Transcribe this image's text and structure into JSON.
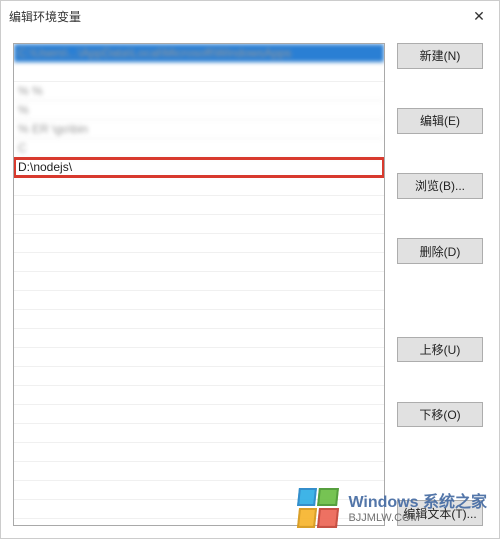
{
  "dialog": {
    "title": "编辑环境变量"
  },
  "list": {
    "items": [
      {
        "text": "C:\\Users\\...\\AppData\\Local\\Microsoft\\WindowsApps",
        "selected": true,
        "blurred": true
      },
      {
        "text": "",
        "selected": false
      },
      {
        "text": "%           %",
        "selected": false,
        "blurred": true
      },
      {
        "text": "%",
        "selected": false,
        "blurred": true
      },
      {
        "text": "%   ER           \\go\\bin",
        "selected": false,
        "blurred": true
      },
      {
        "text": "C",
        "selected": false,
        "blurred": true
      },
      {
        "text": "D:\\nodejs\\",
        "selected": false,
        "highlighted": true
      }
    ]
  },
  "buttons": {
    "new": "新建(N)",
    "edit": "编辑(E)",
    "browse": "浏览(B)...",
    "delete": "删除(D)",
    "moveUp": "上移(U)",
    "moveDown": "下移(O)",
    "editText": "编辑文本(T)..."
  },
  "watermark": {
    "line1": "Windows 系统之家",
    "line2": "BJJMLW.COM"
  }
}
